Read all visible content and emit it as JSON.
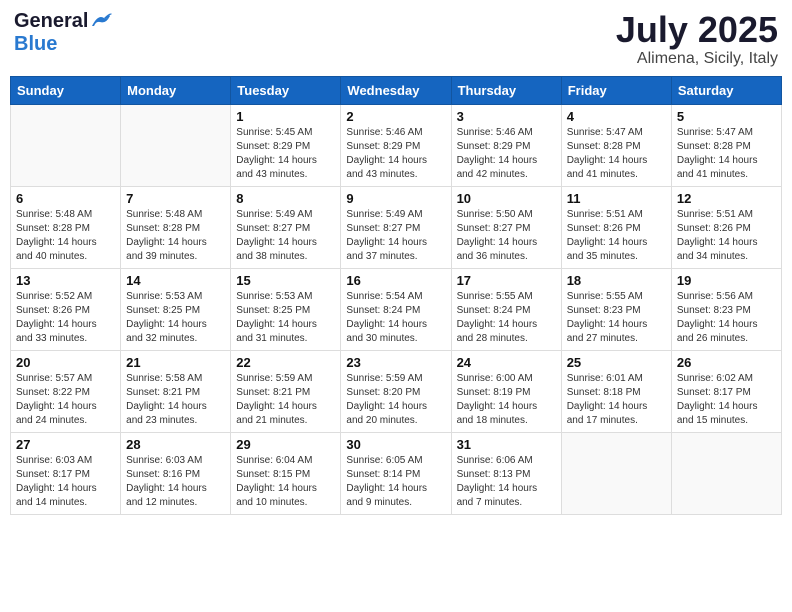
{
  "header": {
    "logo_general": "General",
    "logo_blue": "Blue",
    "month_year": "July 2025",
    "location": "Alimena, Sicily, Italy"
  },
  "days_of_week": [
    "Sunday",
    "Monday",
    "Tuesday",
    "Wednesday",
    "Thursday",
    "Friday",
    "Saturday"
  ],
  "weeks": [
    [
      {
        "day": "",
        "info": ""
      },
      {
        "day": "",
        "info": ""
      },
      {
        "day": "1",
        "info": "Sunrise: 5:45 AM\nSunset: 8:29 PM\nDaylight: 14 hours and 43 minutes."
      },
      {
        "day": "2",
        "info": "Sunrise: 5:46 AM\nSunset: 8:29 PM\nDaylight: 14 hours and 43 minutes."
      },
      {
        "day": "3",
        "info": "Sunrise: 5:46 AM\nSunset: 8:29 PM\nDaylight: 14 hours and 42 minutes."
      },
      {
        "day": "4",
        "info": "Sunrise: 5:47 AM\nSunset: 8:28 PM\nDaylight: 14 hours and 41 minutes."
      },
      {
        "day": "5",
        "info": "Sunrise: 5:47 AM\nSunset: 8:28 PM\nDaylight: 14 hours and 41 minutes."
      }
    ],
    [
      {
        "day": "6",
        "info": "Sunrise: 5:48 AM\nSunset: 8:28 PM\nDaylight: 14 hours and 40 minutes."
      },
      {
        "day": "7",
        "info": "Sunrise: 5:48 AM\nSunset: 8:28 PM\nDaylight: 14 hours and 39 minutes."
      },
      {
        "day": "8",
        "info": "Sunrise: 5:49 AM\nSunset: 8:27 PM\nDaylight: 14 hours and 38 minutes."
      },
      {
        "day": "9",
        "info": "Sunrise: 5:49 AM\nSunset: 8:27 PM\nDaylight: 14 hours and 37 minutes."
      },
      {
        "day": "10",
        "info": "Sunrise: 5:50 AM\nSunset: 8:27 PM\nDaylight: 14 hours and 36 minutes."
      },
      {
        "day": "11",
        "info": "Sunrise: 5:51 AM\nSunset: 8:26 PM\nDaylight: 14 hours and 35 minutes."
      },
      {
        "day": "12",
        "info": "Sunrise: 5:51 AM\nSunset: 8:26 PM\nDaylight: 14 hours and 34 minutes."
      }
    ],
    [
      {
        "day": "13",
        "info": "Sunrise: 5:52 AM\nSunset: 8:26 PM\nDaylight: 14 hours and 33 minutes."
      },
      {
        "day": "14",
        "info": "Sunrise: 5:53 AM\nSunset: 8:25 PM\nDaylight: 14 hours and 32 minutes."
      },
      {
        "day": "15",
        "info": "Sunrise: 5:53 AM\nSunset: 8:25 PM\nDaylight: 14 hours and 31 minutes."
      },
      {
        "day": "16",
        "info": "Sunrise: 5:54 AM\nSunset: 8:24 PM\nDaylight: 14 hours and 30 minutes."
      },
      {
        "day": "17",
        "info": "Sunrise: 5:55 AM\nSunset: 8:24 PM\nDaylight: 14 hours and 28 minutes."
      },
      {
        "day": "18",
        "info": "Sunrise: 5:55 AM\nSunset: 8:23 PM\nDaylight: 14 hours and 27 minutes."
      },
      {
        "day": "19",
        "info": "Sunrise: 5:56 AM\nSunset: 8:23 PM\nDaylight: 14 hours and 26 minutes."
      }
    ],
    [
      {
        "day": "20",
        "info": "Sunrise: 5:57 AM\nSunset: 8:22 PM\nDaylight: 14 hours and 24 minutes."
      },
      {
        "day": "21",
        "info": "Sunrise: 5:58 AM\nSunset: 8:21 PM\nDaylight: 14 hours and 23 minutes."
      },
      {
        "day": "22",
        "info": "Sunrise: 5:59 AM\nSunset: 8:21 PM\nDaylight: 14 hours and 21 minutes."
      },
      {
        "day": "23",
        "info": "Sunrise: 5:59 AM\nSunset: 8:20 PM\nDaylight: 14 hours and 20 minutes."
      },
      {
        "day": "24",
        "info": "Sunrise: 6:00 AM\nSunset: 8:19 PM\nDaylight: 14 hours and 18 minutes."
      },
      {
        "day": "25",
        "info": "Sunrise: 6:01 AM\nSunset: 8:18 PM\nDaylight: 14 hours and 17 minutes."
      },
      {
        "day": "26",
        "info": "Sunrise: 6:02 AM\nSunset: 8:17 PM\nDaylight: 14 hours and 15 minutes."
      }
    ],
    [
      {
        "day": "27",
        "info": "Sunrise: 6:03 AM\nSunset: 8:17 PM\nDaylight: 14 hours and 14 minutes."
      },
      {
        "day": "28",
        "info": "Sunrise: 6:03 AM\nSunset: 8:16 PM\nDaylight: 14 hours and 12 minutes."
      },
      {
        "day": "29",
        "info": "Sunrise: 6:04 AM\nSunset: 8:15 PM\nDaylight: 14 hours and 10 minutes."
      },
      {
        "day": "30",
        "info": "Sunrise: 6:05 AM\nSunset: 8:14 PM\nDaylight: 14 hours and 9 minutes."
      },
      {
        "day": "31",
        "info": "Sunrise: 6:06 AM\nSunset: 8:13 PM\nDaylight: 14 hours and 7 minutes."
      },
      {
        "day": "",
        "info": ""
      },
      {
        "day": "",
        "info": ""
      }
    ]
  ]
}
